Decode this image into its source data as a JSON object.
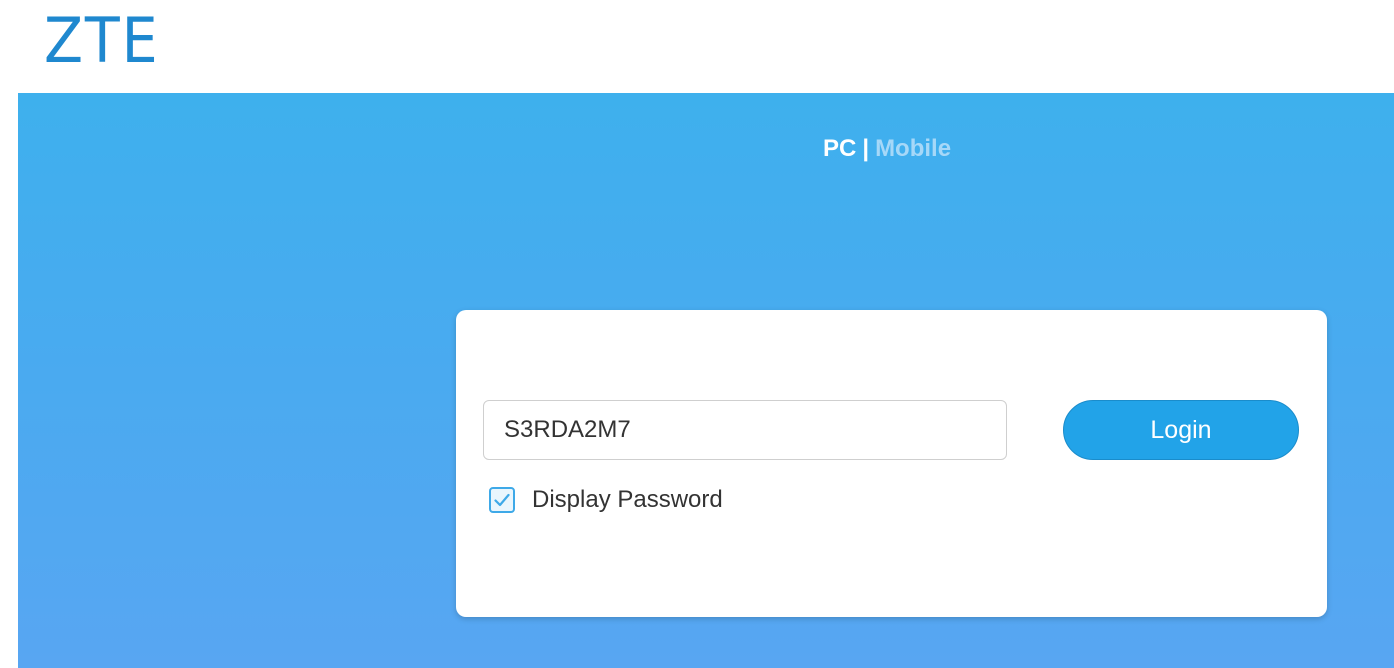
{
  "brand": {
    "logo_text": "ZTE",
    "color": "#1f88cf"
  },
  "mode_switch": {
    "pc_label": "PC",
    "separator": "|",
    "mobile_label": "Mobile",
    "active": "PC"
  },
  "login_form": {
    "password_value": "S3RDA2M7",
    "login_label": "Login",
    "display_password_label": "Display Password",
    "display_password_checked": true
  },
  "colors": {
    "banner": "#3eb0ed",
    "accent": "#22a3e8",
    "inactive_link": "#a6d8f8"
  },
  "icons": {
    "checkbox": "check-icon"
  }
}
